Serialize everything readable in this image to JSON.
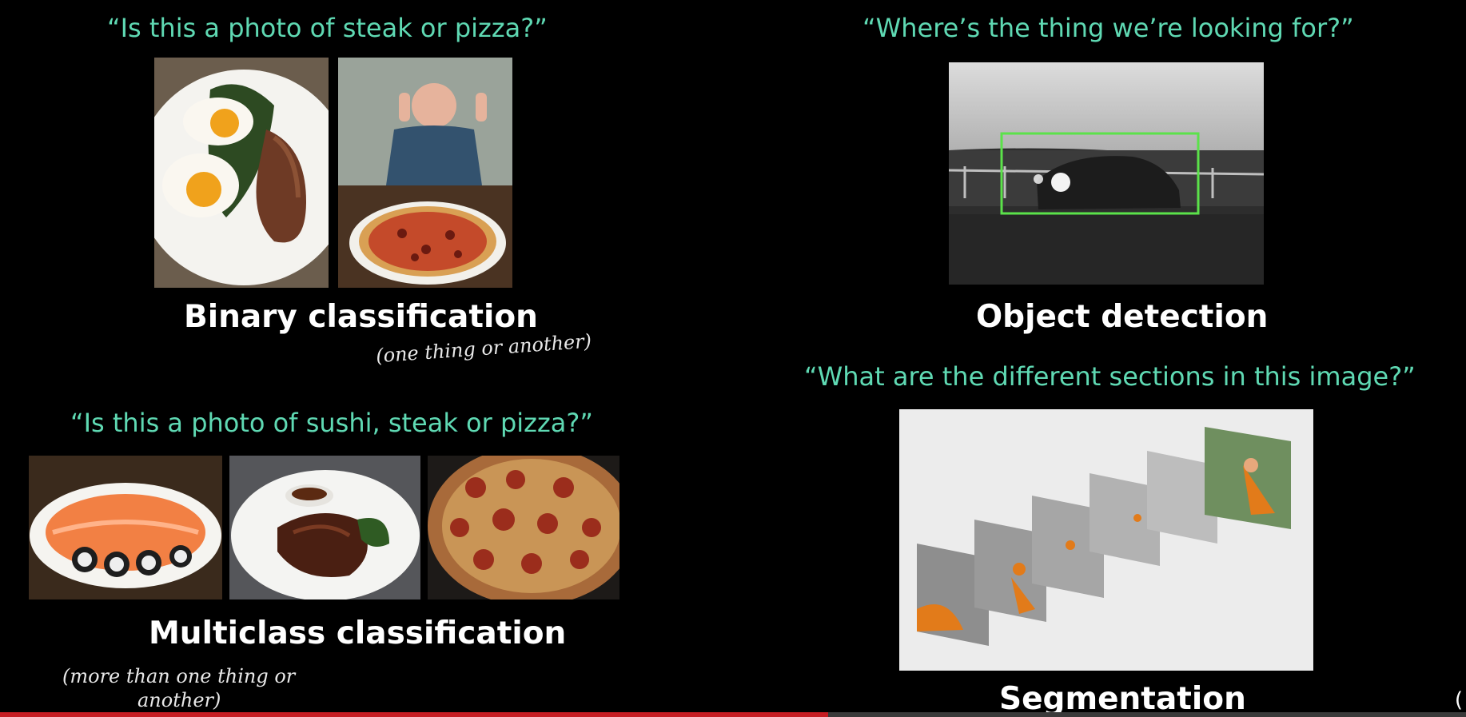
{
  "binary": {
    "question": "“Is this a photo of steak or pizza?”",
    "label": "Binary classification",
    "note": "(one thing or another)"
  },
  "object": {
    "question": "“Where’s the thing we’re looking for?”",
    "label": "Object detection"
  },
  "multiclass": {
    "question": "“Is this a photo of sushi, steak or pizza?”",
    "label": "Multiclass classification",
    "note_line1": "(more than one thing or",
    "note_line2": "another)"
  },
  "segmentation": {
    "question": "“What are the different sections in this image?”",
    "label": "Segmentation"
  },
  "video_progress": 0.565,
  "colors": {
    "question": "#5fd9b3",
    "detection_box": "#5be24a",
    "progress": "#c61d23"
  }
}
